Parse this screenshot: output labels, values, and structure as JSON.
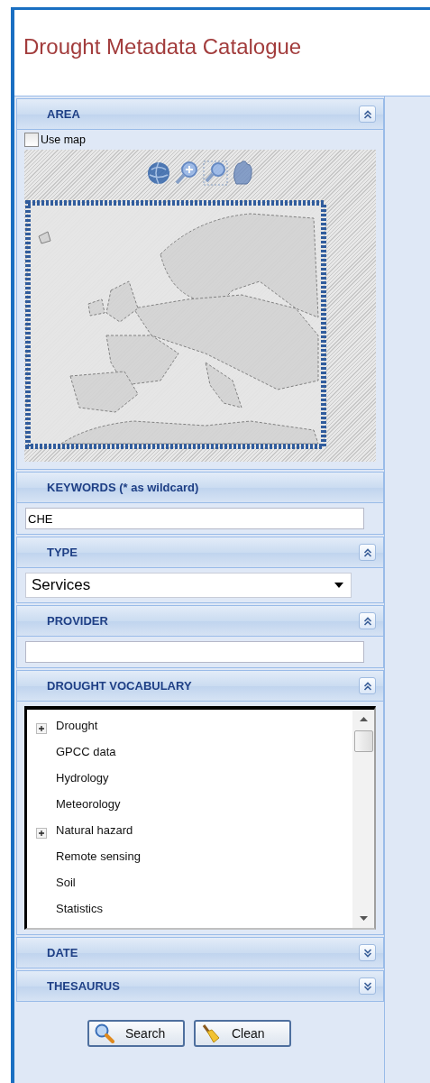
{
  "header": {
    "title": "Drought Metadata Catalogue"
  },
  "panels": [
    {
      "title": "AREA",
      "kind": "map",
      "expanded": true,
      "use_map": {
        "label": "Use map",
        "checked": false
      }
    },
    {
      "title": "KEYWORDS (* as wildcard)",
      "kind": "text",
      "value": "CHE"
    },
    {
      "title": "TYPE",
      "kind": "select",
      "expanded": true,
      "value": "Services"
    },
    {
      "title": "PROVIDER",
      "kind": "text",
      "expanded": true
    },
    {
      "title": "DROUGHT VOCABULARY",
      "kind": "tree",
      "expanded": true,
      "items": [
        {
          "label": "Drought",
          "has_children": true
        },
        {
          "label": "GPCC data",
          "has_children": false
        },
        {
          "label": "Hydrology",
          "has_children": false
        },
        {
          "label": "Meteorology",
          "has_children": false
        },
        {
          "label": "Natural hazard",
          "has_children": true
        },
        {
          "label": "Remote sensing",
          "has_children": false
        },
        {
          "label": "Soil",
          "has_children": false
        },
        {
          "label": "Statistics",
          "has_children": false
        }
      ]
    },
    {
      "title": "DATE",
      "expanded": false
    },
    {
      "title": "THESAURUS",
      "expanded": false
    }
  ],
  "buttons": [
    {
      "label": "Search",
      "kind": "search"
    },
    {
      "label": "Clean",
      "kind": "clean"
    }
  ]
}
